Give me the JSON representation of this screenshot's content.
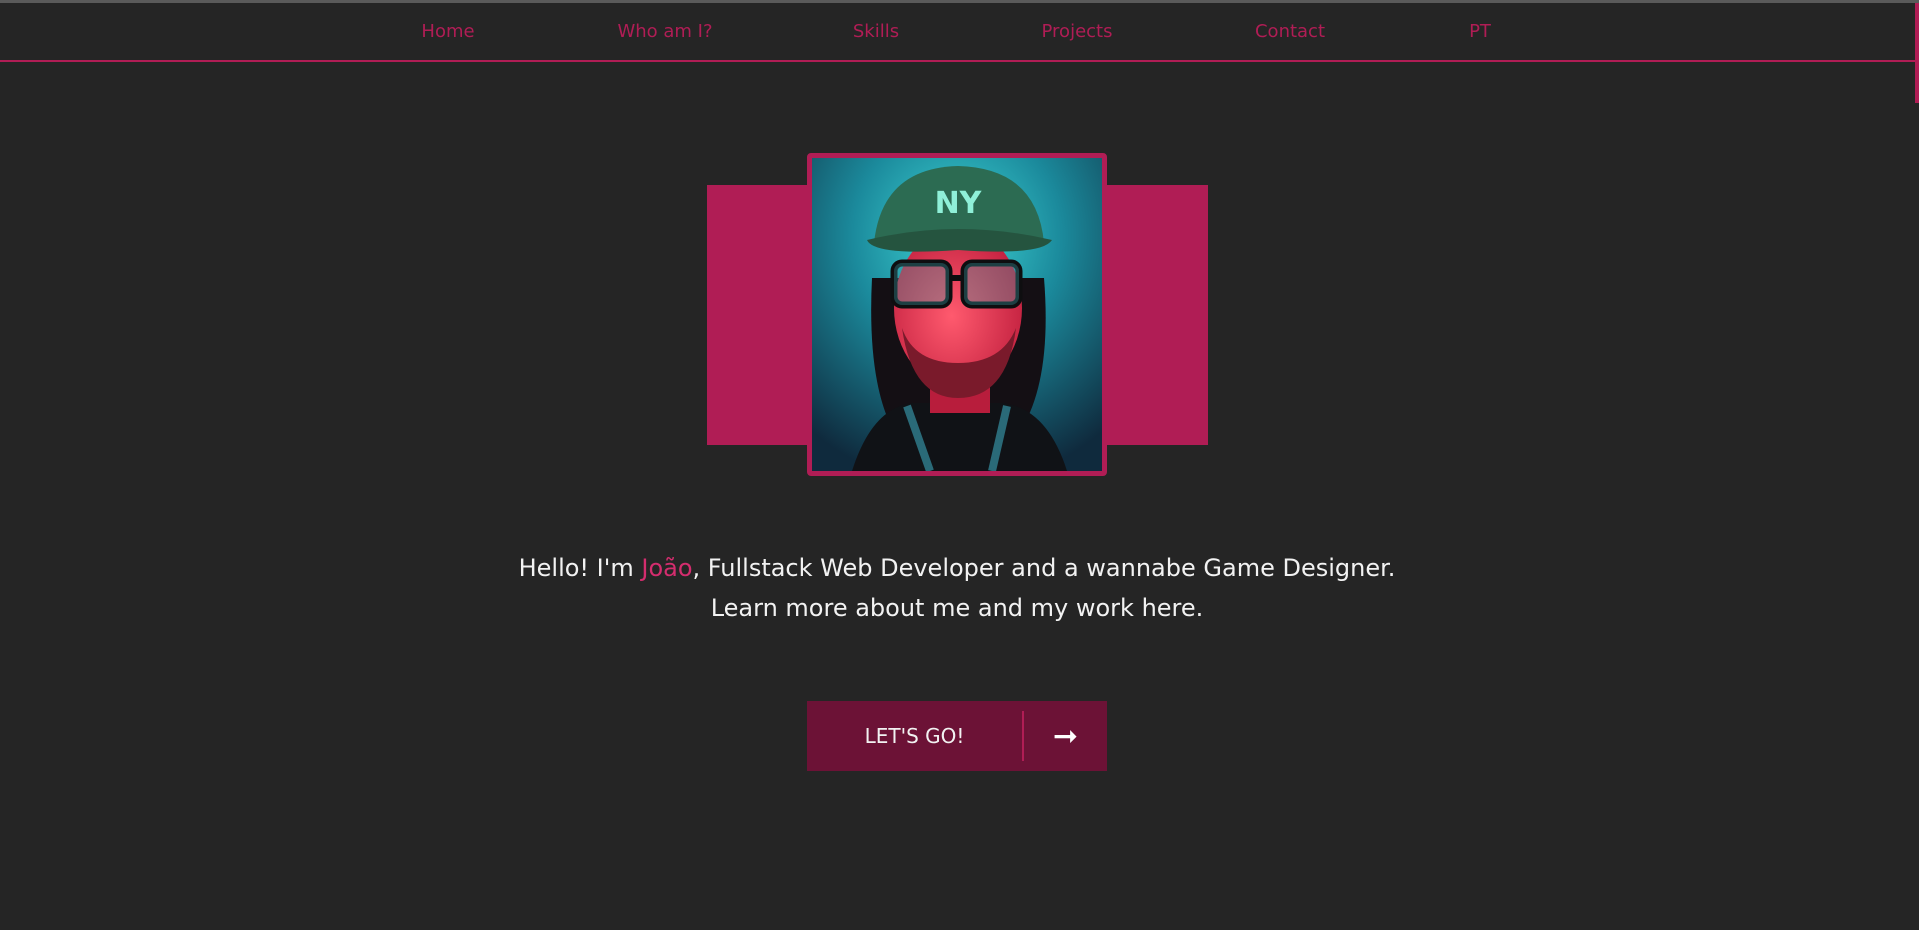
{
  "nav": {
    "items": [
      {
        "label": "Home"
      },
      {
        "label": "Who am I?"
      },
      {
        "label": "Skills"
      },
      {
        "label": "Projects"
      },
      {
        "label": "Contact"
      },
      {
        "label": "PT"
      }
    ]
  },
  "hero": {
    "line1_prefix": "Hello! I'm ",
    "name": "João",
    "line1_suffix": ", Fullstack Web Developer and a wannabe Game Designer.",
    "line2": "Learn more about me and my work here."
  },
  "cta": {
    "label": "LET'S GO!",
    "icon": "arrow-right-icon",
    "arrow_glyph": "➞"
  },
  "colors": {
    "background": "#252525",
    "accent": "#b01d55",
    "accent_dark": "#6c1236",
    "name_highlight": "#d42d6e",
    "text": "#f2f2f2"
  }
}
